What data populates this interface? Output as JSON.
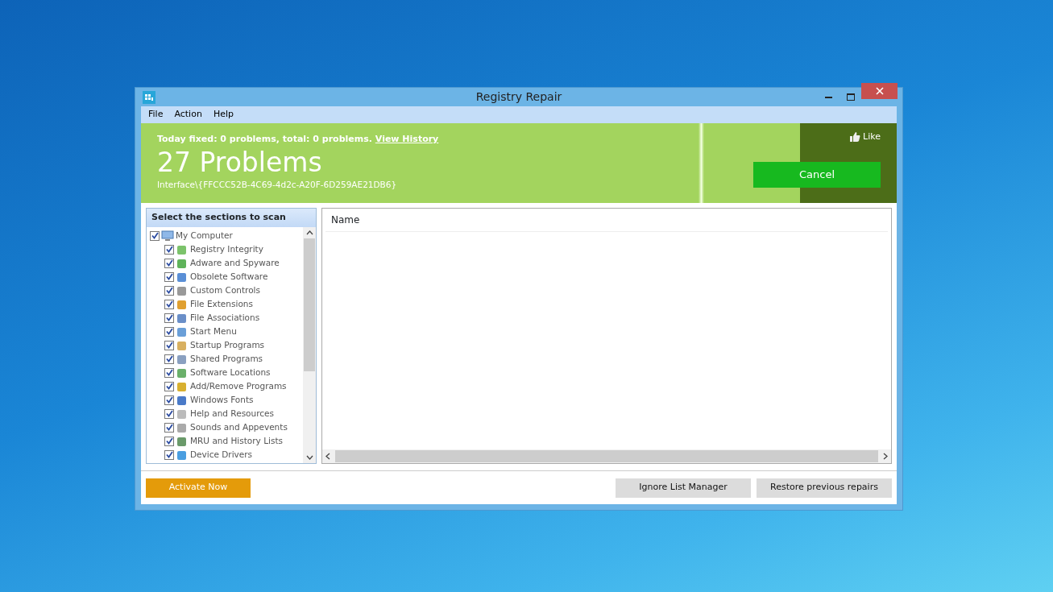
{
  "window": {
    "title": "Registry Repair"
  },
  "menu": [
    "File",
    "Action",
    "Help"
  ],
  "banner": {
    "summary": "Today fixed: 0 problems, total: 0 problems.",
    "history_link": "View History",
    "headline": "27 Problems",
    "current_key": "Interface\\{FFCCC52B-4C69-4d2c-A20F-6D259AE21DB6}",
    "like": "Like",
    "cancel": "Cancel"
  },
  "sections": {
    "title": "Select the sections to scan",
    "tree": [
      {
        "label": "My Computer",
        "checked": true,
        "children": [
          {
            "label": "Registry Integrity",
            "checked": true
          },
          {
            "label": "Adware and Spyware",
            "checked": true
          },
          {
            "label": "Obsolete Software",
            "checked": true
          },
          {
            "label": "Custom Controls",
            "checked": true
          },
          {
            "label": "File Extensions",
            "checked": true
          },
          {
            "label": "File Associations",
            "checked": true
          },
          {
            "label": "Start Menu",
            "checked": true
          },
          {
            "label": "Startup Programs",
            "checked": true
          },
          {
            "label": "Shared Programs",
            "checked": true
          },
          {
            "label": "Software Locations",
            "checked": true
          },
          {
            "label": "Add/Remove Programs",
            "checked": true
          },
          {
            "label": "Windows Fonts",
            "checked": true
          },
          {
            "label": "Help and Resources",
            "checked": true
          },
          {
            "label": "Sounds and Appevents",
            "checked": true
          },
          {
            "label": "MRU and History Lists",
            "checked": true
          },
          {
            "label": "Device Drivers",
            "checked": true
          }
        ]
      }
    ]
  },
  "results": {
    "columns": [
      "Name"
    ]
  },
  "buttons": {
    "activate": "Activate Now",
    "ignore": "Ignore List Manager",
    "restore": "Restore previous repairs"
  }
}
